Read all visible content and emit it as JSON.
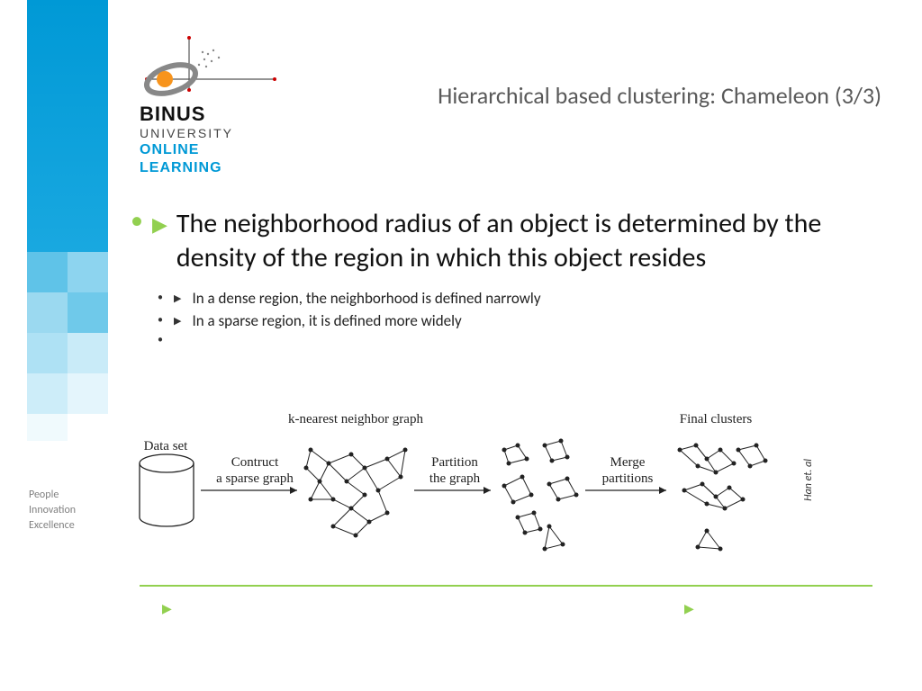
{
  "logo": {
    "line1": "BINUS",
    "line2": "UNIVERSITY",
    "line3": "ONLINE",
    "line4": "LEARNING"
  },
  "title": "Hierarchical based clustering: Chameleon (3/3)",
  "main_bullet": "The neighborhood radius of an object is determined by the density of the region in which this object resides",
  "sub_bullets": [
    "In a dense region, the neighborhood is defined narrowly",
    "In a sparse region, it is defined more widely"
  ],
  "diagram": {
    "top_label": "k-nearest neighbor graph",
    "final_label": "Final clusters",
    "dataset_label": "Data set",
    "step1": "Contruct\na sparse graph",
    "step2": "Partition\nthe graph",
    "step3": "Merge\npartitions",
    "citation": "Han et. al"
  },
  "sidebar": {
    "w1": "People",
    "w2": "Innovation",
    "w3": "Excellence"
  }
}
